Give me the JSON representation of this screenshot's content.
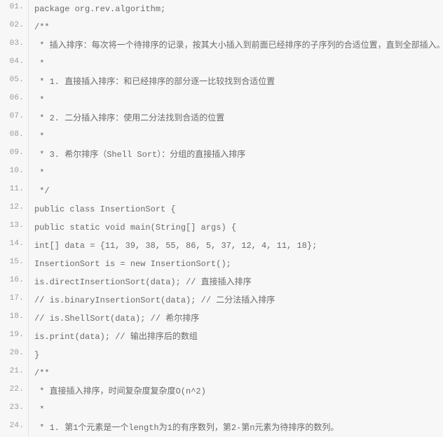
{
  "lines": [
    {
      "num": "01.",
      "code": "package org.rev.algorithm;"
    },
    {
      "num": "02.",
      "code": "/**"
    },
    {
      "num": "03.",
      "code": " * 插入排序：每次将一个待排序的记录，按其大小插入到前面已经排序的子序列的合适位置，直到全部插入。"
    },
    {
      "num": "04.",
      "code": " *"
    },
    {
      "num": "05.",
      "code": " * 1. 直接插入排序：和已经排序的部分逐一比较找到合适位置"
    },
    {
      "num": "06.",
      "code": " *"
    },
    {
      "num": "07.",
      "code": " * 2. 二分插入排序：使用二分法找到合适的位置"
    },
    {
      "num": "08.",
      "code": " *"
    },
    {
      "num": "09.",
      "code": " * 3. 希尔排序（Shell Sort）：分组的直接插入排序"
    },
    {
      "num": "10.",
      "code": " *"
    },
    {
      "num": "11.",
      "code": " */"
    },
    {
      "num": "12.",
      "code": "public class InsertionSort {"
    },
    {
      "num": "13.",
      "code": "public static void main(String[] args) {"
    },
    {
      "num": "14.",
      "code": "int[] data = {11, 39, 38, 55, 86, 5, 37, 12, 4, 11, 18};"
    },
    {
      "num": "15.",
      "code": "InsertionSort is = new InsertionSort();"
    },
    {
      "num": "16.",
      "code": "is.directInsertionSort(data); // 直接插入排序"
    },
    {
      "num": "17.",
      "code": "// is.binaryInsertionSort(data); // 二分法插入排序"
    },
    {
      "num": "18.",
      "code": "// is.ShellSort(data); // 希尔排序"
    },
    {
      "num": "19.",
      "code": "is.print(data); // 输出排序后的数组"
    },
    {
      "num": "20.",
      "code": "}"
    },
    {
      "num": "21.",
      "code": "/**"
    },
    {
      "num": "22.",
      "code": " * 直接插入排序，时间复杂度复杂度O(n^2)"
    },
    {
      "num": "23.",
      "code": " *"
    },
    {
      "num": "24.",
      "code": " * 1. 第1个元素是一个length为1的有序数列，第2-第n元素为待排序的数列。"
    }
  ]
}
